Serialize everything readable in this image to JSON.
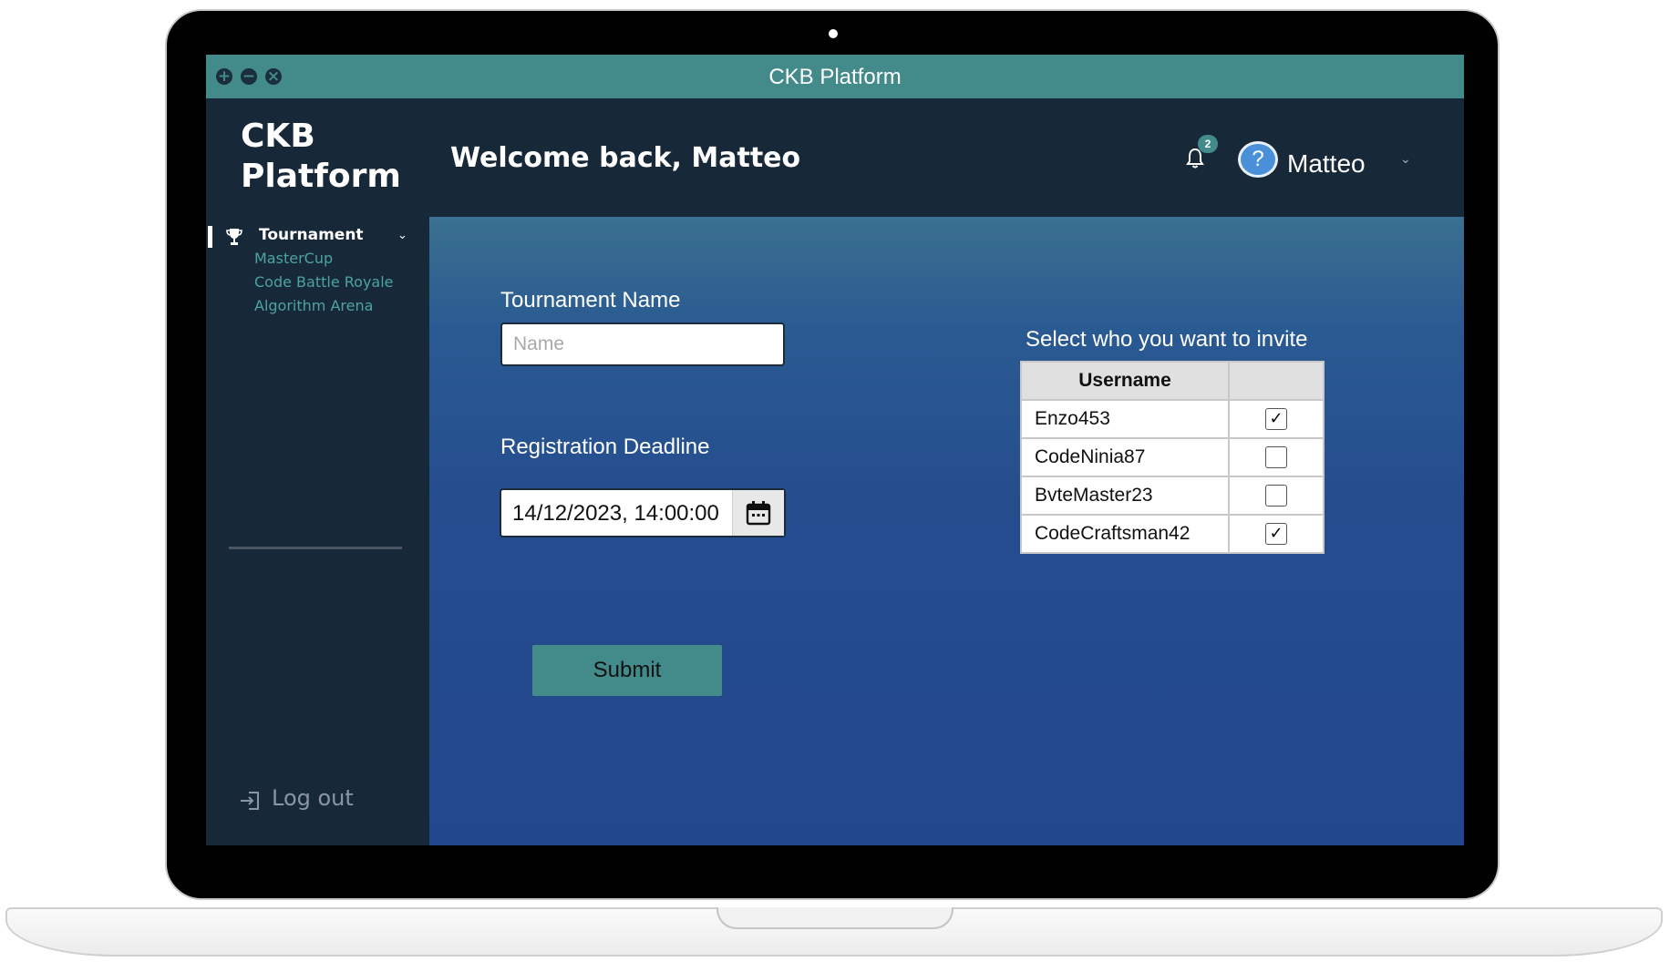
{
  "window": {
    "title": "CKB Platform",
    "buttons": {
      "maximize": "+",
      "minimize": "−",
      "close": "×"
    }
  },
  "header": {
    "brand_line1": "CKB",
    "brand_line2": "Platform",
    "welcome": "Welcome back, Matteo",
    "notification_count": "2",
    "user_name": "Matteo",
    "avatar_glyph": "?",
    "chevron": "⌄"
  },
  "sidebar": {
    "section_label": "Tournament",
    "section_chevron": "⌄",
    "items": [
      {
        "label": "MasterCup"
      },
      {
        "label": "Code Battle Royale"
      },
      {
        "label": "Algorithm Arena"
      }
    ],
    "logout_label": "Log out"
  },
  "form": {
    "name_label": "Tournament Name",
    "name_placeholder": "Name",
    "deadline_label": "Registration Deadline",
    "deadline_value": "14/12/2023, 14:00:00",
    "submit_label": "Submit"
  },
  "invite": {
    "title": "Select who you want to invite",
    "column_header": "Username",
    "rows": [
      {
        "username": "Enzo453",
        "checked": true,
        "mark": "✓"
      },
      {
        "username": "CodeNinia87",
        "checked": false,
        "mark": ""
      },
      {
        "username": "BvteMaster23",
        "checked": false,
        "mark": ""
      },
      {
        "username": "CodeCraftsman42",
        "checked": true,
        "mark": "✓"
      }
    ]
  },
  "colors": {
    "accent": "#438a8b",
    "background": "#172839",
    "panel_top": "#3a7090",
    "panel_bottom": "#23478d"
  },
  "icons": [
    "plus-icon",
    "minus-icon",
    "close-icon",
    "bell-icon",
    "avatar-icon",
    "chevron-down-icon",
    "trophy-icon",
    "logout-icon",
    "calendar-icon"
  ]
}
